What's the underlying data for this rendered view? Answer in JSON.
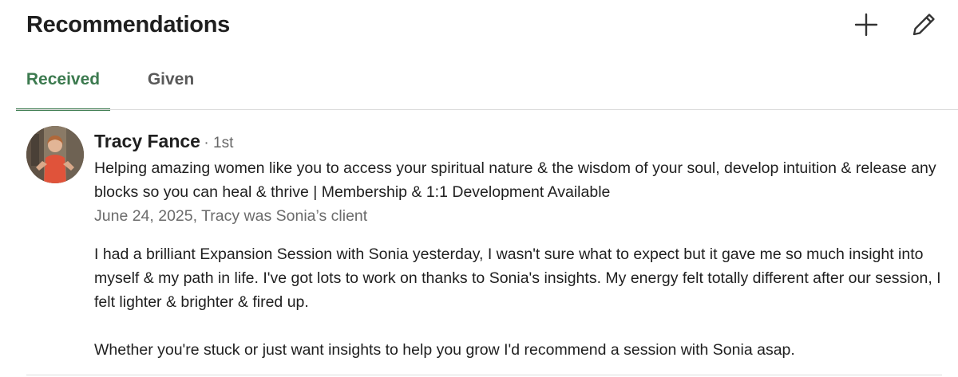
{
  "header": {
    "title": "Recommendations",
    "add_icon": "plus-icon",
    "edit_icon": "pencil-icon"
  },
  "tabs": [
    {
      "label": "Received",
      "active": true
    },
    {
      "label": "Given",
      "active": false
    }
  ],
  "colors": {
    "accent": "#3c7a4f",
    "divider": "#dcdcdc",
    "meta_text": "#6b6b6b"
  },
  "recommendation": {
    "author": "Tracy Fance",
    "degree": "· 1st",
    "headline": "Helping amazing women like you to access your spiritual nature & the wisdom of your soul, develop intuition & release any blocks so you can heal & thrive | Membership & 1:1 Development Available",
    "meta": "June 24, 2025, Tracy was Sonia’s client",
    "paragraphs": [
      "I had a brilliant Expansion Session with Sonia yesterday, I wasn't sure what to expect but it gave me so much insight into myself & my path in life. I've got lots to work on thanks to Sonia's insights. My energy felt totally different after our session, I felt lighter & brighter & fired up.",
      "Whether you're stuck or just want insights to help you grow I'd recommend a session with Sonia asap."
    ]
  }
}
